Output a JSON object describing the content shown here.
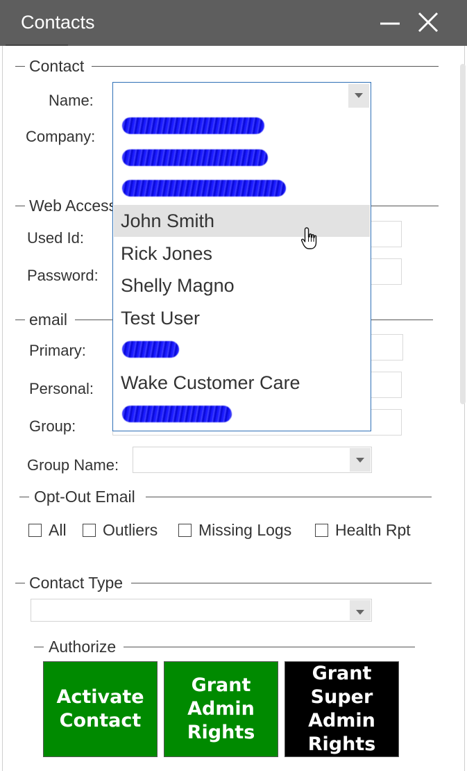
{
  "window": {
    "title": "Contacts"
  },
  "contact": {
    "legend": "Contact",
    "name_label": "Name:",
    "company_label": "Company:"
  },
  "web_access": {
    "legend": "Web Access",
    "user_id_label": "Used Id:",
    "password_label": "Password:"
  },
  "email": {
    "legend": "email",
    "primary_label": "Primary:",
    "personal_label": "Personal:",
    "group_label": "Group:",
    "group_name_label": "Group Name:"
  },
  "opt_out": {
    "legend": "Opt-Out Email",
    "options": [
      "All",
      "Outliers",
      "Missing Logs",
      "Health Rpt"
    ]
  },
  "contact_type": {
    "legend": "Contact Type"
  },
  "authorize": {
    "legend": "Authorize",
    "buttons": [
      "Activate\nContact",
      "Grant\nAdmin\nRights",
      "Grant\nSuper\nAdmin\nRights"
    ]
  },
  "name_dropdown": {
    "items": [
      "John Smith",
      "Rick Jones",
      "Shelly Magno",
      "Test User",
      "Wake Customer Care"
    ],
    "hovered": "John Smith"
  },
  "colors": {
    "titlebar": "#5e5e5e",
    "accent_green": "#008a00",
    "accent_black": "#000000",
    "dropdown_border": "#2e6fb6"
  }
}
